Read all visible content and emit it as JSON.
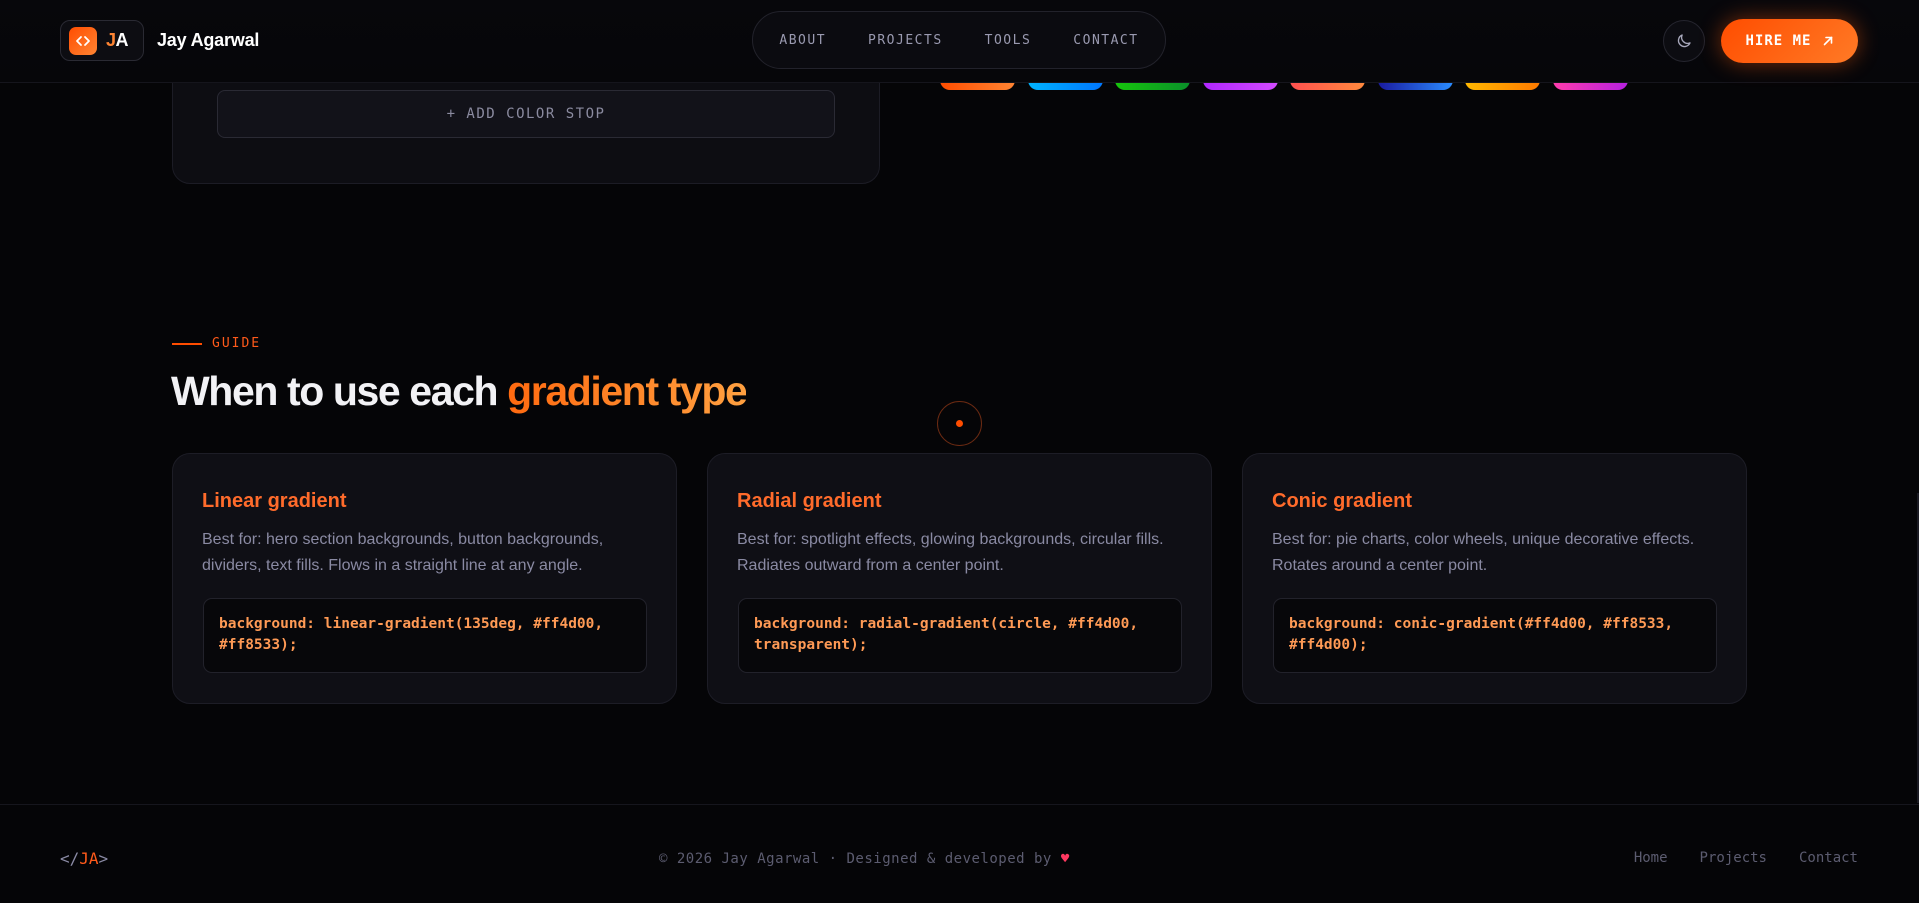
{
  "header": {
    "logo_initials_j": "J",
    "logo_initials_a": "A",
    "brand_name": "Jay Agarwal",
    "nav": [
      "ABOUT",
      "PROJECTS",
      "TOOLS",
      "CONTACT"
    ],
    "theme_icon": "moon-icon",
    "hire_label": "HIRE ME",
    "hire_icon": "arrow-up-right-icon"
  },
  "editor": {
    "add_stop_label": "+ ADD COLOR STOP"
  },
  "presets": [
    {
      "colors": [
        "#ff4d00",
        "#ff8533"
      ]
    },
    {
      "colors": [
        "#00b4ff",
        "#0077ff"
      ]
    },
    {
      "colors": [
        "#16c60c",
        "#0a8f2a"
      ]
    },
    {
      "colors": [
        "#b026ff",
        "#d34bff"
      ]
    },
    {
      "colors": [
        "#ff5050",
        "#ff8a3d"
      ]
    },
    {
      "colors": [
        "#1a1aa0",
        "#2a8cff"
      ]
    },
    {
      "colors": [
        "#ffb800",
        "#ff7a00"
      ]
    },
    {
      "colors": [
        "#ff3cac",
        "#b620e0"
      ]
    }
  ],
  "guide": {
    "eyebrow": "GUIDE",
    "heading_prefix": "When to use each ",
    "heading_accent": "gradient type",
    "cards": [
      {
        "title": "Linear gradient",
        "description": "Best for: hero section backgrounds, button backgrounds, dividers, text fills. Flows in a straight line at any angle.",
        "code_line1": "background: linear-gradient(135deg, #ff4d00,",
        "code_line2": "#ff8533);"
      },
      {
        "title": "Radial gradient",
        "description": "Best for: spotlight effects, glowing backgrounds, circular fills. Radiates outward from a center point.",
        "code_line1": "background: radial-gradient(circle, #ff4d00,",
        "code_line2": "transparent);"
      },
      {
        "title": "Conic gradient",
        "description": "Best for: pie charts, color wheels, unique decorative effects. Rotates around a center point.",
        "code_line1": "background: conic-gradient(#ff4d00, #ff8533,",
        "code_line2": "#ff4d00);"
      }
    ]
  },
  "footer": {
    "logo_open": "</",
    "logo_ja": "JA",
    "logo_close": ">",
    "copyright": "© 2026 Jay Agarwal · Designed & developed by",
    "heart": "♥",
    "links": [
      "Home",
      "Projects",
      "Contact"
    ]
  },
  "colors": {
    "accent": "#ff4d00",
    "accent_light": "#ff8533",
    "background": "#050507",
    "card_bg": "#0f0f15"
  }
}
